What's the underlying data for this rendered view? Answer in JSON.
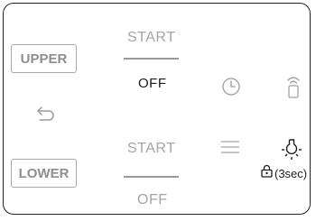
{
  "buttons": {
    "upper_label": "UPPER",
    "lower_label": "LOWER"
  },
  "upper": {
    "start_label": "START",
    "off_label": "OFF"
  },
  "lower": {
    "start_label": "START",
    "off_label": "OFF"
  },
  "lock": {
    "duration_label": "(3sec)"
  },
  "icons": {
    "back": "back-arrow-icon",
    "clock": "clock-icon",
    "oven_lamp": "oven-lamp-icon",
    "menu": "menu-lines-icon",
    "light": "light-bulb-icon",
    "lock": "lock-icon"
  },
  "colors": {
    "border": "#222222",
    "muted_text": "#a4a4a4",
    "dark_text": "#1b1b1b",
    "button_border": "#a8a8a8"
  }
}
